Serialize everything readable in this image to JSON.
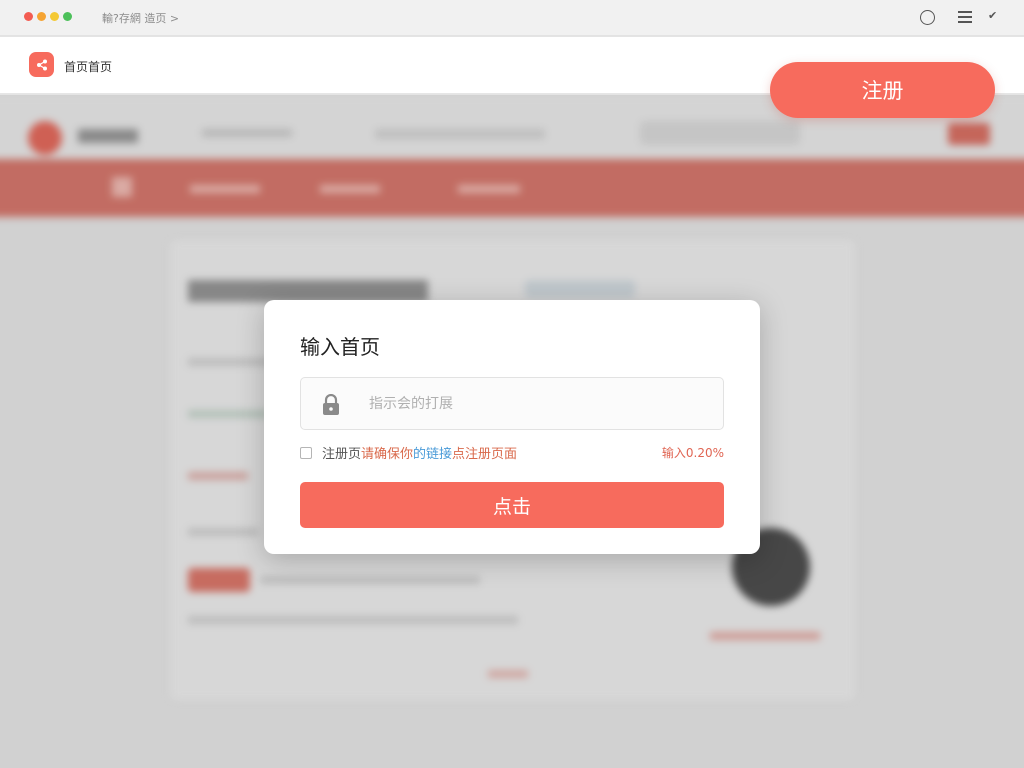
{
  "topbar": {
    "breadcrumb": "輸?存網 造页 >",
    "icons": [
      "circle-icon",
      "menu-icon",
      "checkmark-icon"
    ],
    "window_dots": [
      "#f35c52",
      "#f5a433",
      "#f4c935",
      "#4cc05a"
    ]
  },
  "header": {
    "title": "首页首页",
    "register_label": "注册"
  },
  "modal": {
    "title": "输入首页",
    "password_placeholder": "指示会的打展",
    "agree_prefix": "注册页",
    "agree_orange": "请确保你",
    "agree_blue": "的链接",
    "agree_suffix": "点注册页面",
    "note": "输入0.20%",
    "submit_label": "点击"
  },
  "colors": {
    "accent": "#f76b5d",
    "link_blue": "#4a9bd8",
    "note_red": "#e06553"
  }
}
